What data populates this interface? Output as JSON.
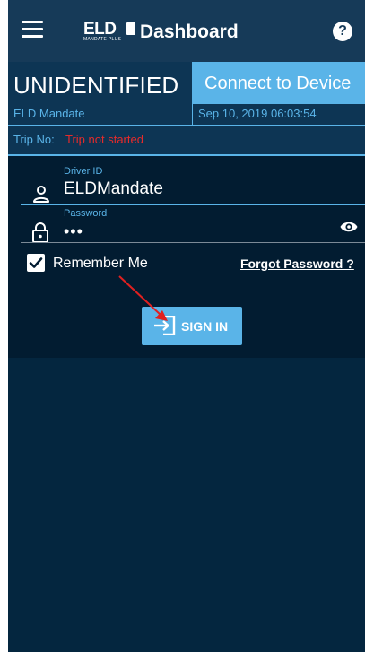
{
  "appbar": {
    "title": "Dashboard",
    "logo": {
      "text": "ELD",
      "subtext": "MANDATE PLUS"
    }
  },
  "status": {
    "driver_status": "UNIDENTIFIED",
    "connect_label": "Connect to Device",
    "eld_label": "ELD Mandate",
    "datetime": "Sep 10, 2019 06:03:54",
    "trip_label": "Trip No:",
    "trip_value": "Trip not started"
  },
  "login": {
    "driver_id_label": "Driver ID",
    "driver_id_value": "ELDMandate",
    "password_label": "Password",
    "password_value": "•••",
    "remember_me_label": "Remember Me",
    "remember_me_checked": true,
    "forgot_password_label": "Forgot Password ?",
    "signin_label": "SIGN IN"
  },
  "icons": {
    "menu": "menu-icon",
    "help": "help-icon",
    "user": "user-icon",
    "lock": "lock-icon",
    "visibility": "eye-icon",
    "checkbox": "checkbox-checked-icon",
    "signin": "login-arrow-icon"
  },
  "colors": {
    "background": "#04263f",
    "appbar": "#163a58",
    "accent": "#5ab4e8",
    "error": "#e52b2b",
    "annotation": "#e02020"
  }
}
